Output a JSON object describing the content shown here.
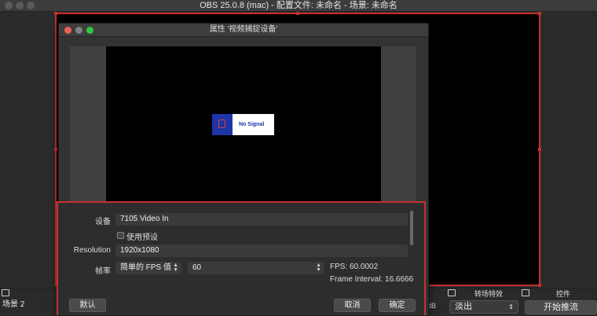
{
  "window": {
    "title": "OBS 25.0.8 (mac) - 配置文件: 未命名 - 场景: 未命名"
  },
  "main": {
    "scene_item": "场景 2",
    "transition_label": "转场特效",
    "controls_label": "控件",
    "transition_value": "淡出",
    "start_stream": "开始推流",
    "db": "dB"
  },
  "dialog": {
    "title": "属性 '视频捕捉设备'",
    "no_signal": "No Signal",
    "device_label": "设备",
    "device_value": "7105 Video In",
    "use_preset_label": "使用预设",
    "resolution_label": "Resolution",
    "resolution_value": "1920x1080",
    "framerate_label": "帧率",
    "fps_mode": "简单的 FPS 值",
    "fps_value": "60",
    "fps_info": "FPS: 60.0002",
    "frame_interval": "Frame Interval: 16.6666",
    "default_btn": "默认",
    "cancel_btn": "取消",
    "ok_btn": "确定"
  },
  "colors": {
    "accent_red": "#c8302d",
    "no_signal_blue": "#1d35a8"
  }
}
